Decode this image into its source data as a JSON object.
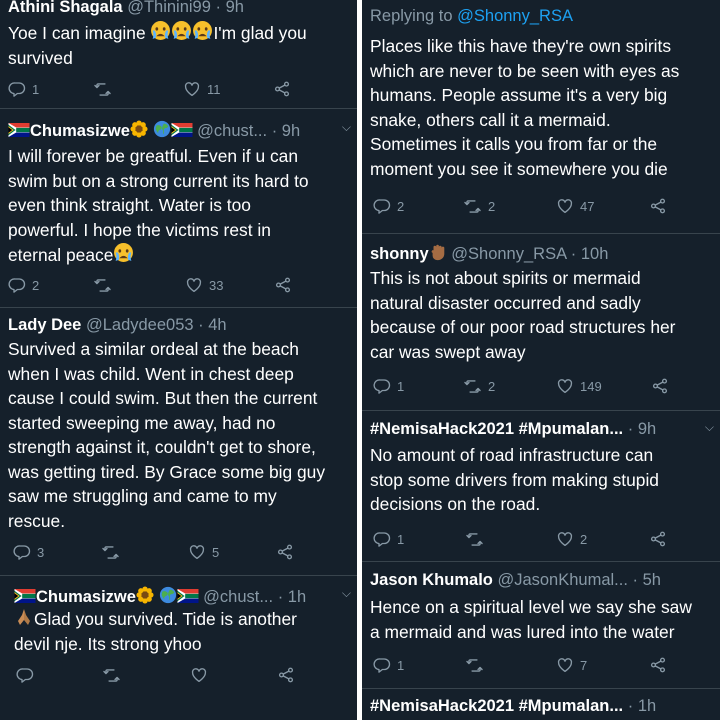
{
  "left": {
    "tweets": [
      {
        "name": "Athini Shagala",
        "handle": "@Thinini99",
        "time": "· 9h",
        "text_a": "Yoe I can imagine ",
        "text_b": "I'm glad you",
        "text_c": "survived",
        "replies": "1",
        "retweets": "",
        "likes": "11"
      },
      {
        "name": "Chumasizwe",
        "handle": "@chust...",
        "time": "· 9h",
        "lines": [
          "I will forever be greatful. Even if u can",
          "swim but on a strong current its hard to",
          "even think straight. Water is too",
          "powerful. I hope the victims rest in"
        ],
        "last_line": "eternal peace",
        "replies": "2",
        "retweets": "",
        "likes": "33"
      },
      {
        "name": "Lady Dee",
        "handle": "@Ladydee053",
        "time": "· 4h",
        "lines": [
          "Survived a similar ordeal at the beach",
          "when I was child. Went in  chest deep",
          "cause I could swim. But then the current",
          "started sweeping me away, had no",
          "strength against it, couldn't get to shore,",
          "was getting tired. By Grace some big guy",
          "saw me struggling  and came to my",
          "rescue."
        ],
        "replies": "3",
        "retweets": "",
        "likes": "5"
      },
      {
        "name": "Chumasizwe",
        "handle": "@chust...",
        "time": "· 1h",
        "line1": "Glad you survived. Tide is another",
        "line2": "devil nje. Its strong yhoo",
        "replies": "",
        "retweets": "",
        "likes": ""
      }
    ]
  },
  "right": {
    "tweets": [
      {
        "replying_label": "Replying to ",
        "replying_handle": "@Shonny_RSA",
        "lines": [
          "Places like this have they're own spirits",
          "which are never to be seen with eyes as",
          "humans. People assume it's a very big",
          "snake, others call it a mermaid.",
          "Sometimes it calls you from far or the",
          "moment you see it somewhere you die"
        ],
        "replies": "2",
        "retweets": "2",
        "likes": "47"
      },
      {
        "name": "shonny",
        "handle": "@Shonny_RSA",
        "time": "· 10h",
        "lines": [
          "This is not about spirits or mermaid",
          "natural disaster occurred and sadly",
          "because of our poor road structures her",
          "car was swept away"
        ],
        "replies": "1",
        "retweets": "2",
        "likes": "149"
      },
      {
        "name": "#NemisaHack2021 #Mpumalan...",
        "handle": "",
        "time": "· 9h",
        "lines": [
          "No amount of road infrastructure can",
          "stop some drivers from making stupid",
          "decisions on the road."
        ],
        "replies": "1",
        "retweets": "",
        "likes": "2"
      },
      {
        "name": "Jason Khumalo",
        "handle": "@JasonKhumal...",
        "time": "· 5h",
        "lines": [
          "Hence on a spiritual level we say she saw",
          "a mermaid and was lured into the water"
        ],
        "replies": "1",
        "retweets": "",
        "likes": "7"
      },
      {
        "name": "#NemisaHack2021 #Mpumalan...",
        "handle": "",
        "time": "· 1h",
        "lines": [],
        "replies": "",
        "retweets": "",
        "likes": ""
      }
    ]
  },
  "colors": {
    "background": "#15202b",
    "text": "#ffffff",
    "secondary": "#8899a6",
    "link": "#1da1f2",
    "separator": "#38444d"
  },
  "icons": [
    "reply-icon",
    "retweet-icon",
    "like-icon",
    "share-icon",
    "chevron-down-icon",
    "crying-face-emoji",
    "sunflower-emoji",
    "globe-emoji",
    "south-africa-flag",
    "raised-fist-emoji",
    "folded-hands-emoji"
  ]
}
